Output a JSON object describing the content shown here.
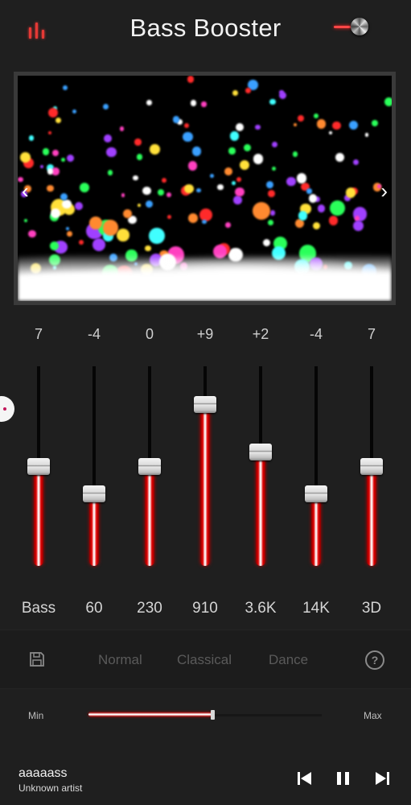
{
  "header": {
    "title": "Bass Booster",
    "left_icon": "equalizer-bars-icon",
    "right_control": "power-toggle",
    "accent_color": "#e53935"
  },
  "visualizer": {
    "prev_arrow": "‹",
    "next_arrow": "›"
  },
  "equalizer": {
    "range": [
      -15,
      15
    ],
    "bands": [
      {
        "label": "Bass",
        "value_text": "7",
        "value": 7
      },
      {
        "label": "60",
        "value_text": "-4",
        "value": -4
      },
      {
        "label": "230",
        "value_text": "0",
        "value": 0
      },
      {
        "label": "910",
        "value_text": "+9",
        "value": 9
      },
      {
        "label": "3.6K",
        "value_text": "+2",
        "value": 2
      },
      {
        "label": "14K",
        "value_text": "-4",
        "value": -4
      },
      {
        "label": "3D",
        "value_text": "7",
        "value": 7
      }
    ],
    "level_fractions": [
      0.5,
      0.36,
      0.5,
      0.81,
      0.57,
      0.36,
      0.5
    ]
  },
  "presets": {
    "save_icon": "floppy-disk-icon",
    "items": [
      "Normal",
      "Classical",
      "Dance"
    ],
    "help_icon": "question-circle-icon",
    "help_glyph": "?"
  },
  "boost": {
    "min_label": "Min",
    "max_label": "Max",
    "level": 0.53
  },
  "player": {
    "title": "aaaaass",
    "artist": "Unknown artist",
    "controls": [
      "previous-icon",
      "pause-icon",
      "next-icon"
    ]
  }
}
